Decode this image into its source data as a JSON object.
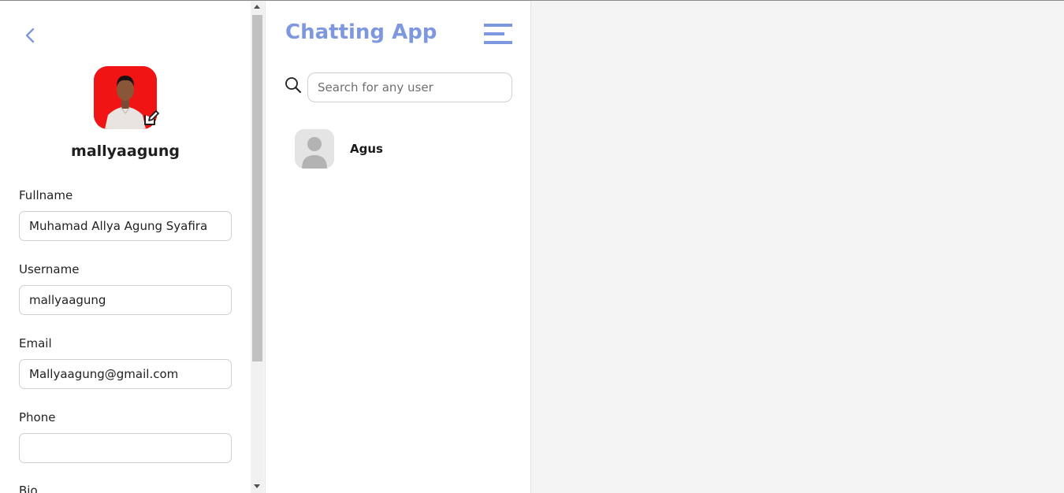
{
  "profile": {
    "username_display": "mallyaagung",
    "fields": [
      {
        "label": "Fullname",
        "value": "Muhamad Allya Agung Syafira"
      },
      {
        "label": "Username",
        "value": "mallyaagung"
      },
      {
        "label": "Email",
        "value": "Mallyaagung@gmail.com"
      },
      {
        "label": "Phone",
        "value": ""
      },
      {
        "label": "Bio",
        "value": ""
      }
    ],
    "avatar_bg": "#f01414",
    "icons": [
      "chevron-left-icon",
      "edit-icon"
    ]
  },
  "contacts": {
    "title": "Chatting App",
    "search": {
      "placeholder": "Search for any user",
      "value": ""
    },
    "items": [
      {
        "name": "Agus"
      }
    ],
    "accent": "#7e98df",
    "icons": [
      "menu-icon",
      "search-icon",
      "default-avatar-icon"
    ]
  }
}
